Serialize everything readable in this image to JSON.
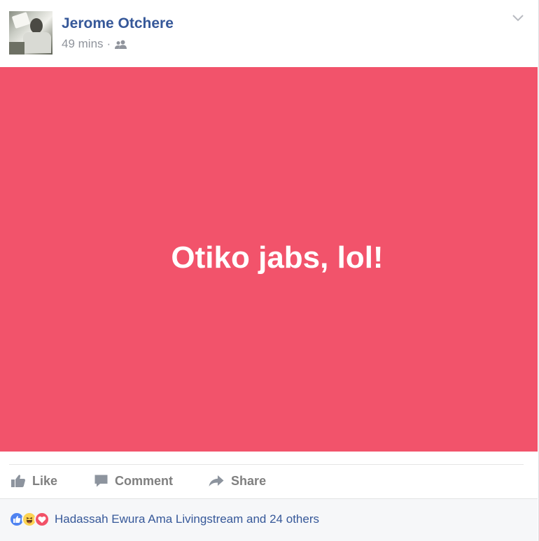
{
  "post": {
    "author_name": "Jerome Otchere",
    "time": "49 mins",
    "separator": "·",
    "privacy_icon": "friends-icon",
    "menu_icon": "chevron-down-icon",
    "content_text": "Otiko jabs, lol!",
    "background_color": "#f2536b"
  },
  "actions": {
    "like_label": "Like",
    "comment_label": "Comment",
    "share_label": "Share"
  },
  "reactions": {
    "icons": [
      "like-reaction-icon",
      "haha-reaction-icon",
      "love-reaction-icon"
    ],
    "summary": "Hadassah Ewura Ama Livingstream and 24 others"
  },
  "colors": {
    "link": "#365899",
    "muted": "#90949c",
    "action": "#7f7f7f"
  }
}
